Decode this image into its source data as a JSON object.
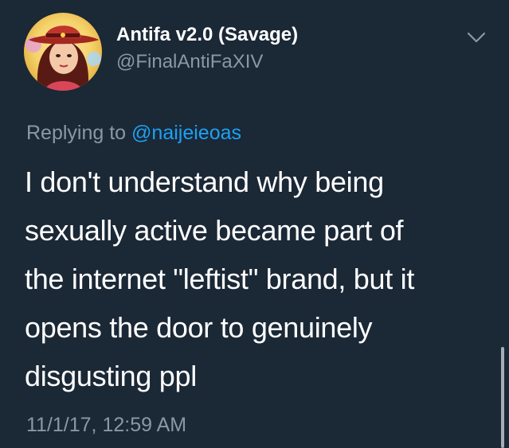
{
  "tweet": {
    "display_name": "Antifa v2.0 (Savage)",
    "handle": "@FinalAntiFaXIV",
    "replying_prefix": "Replying to ",
    "replying_to": "@naijeieoas",
    "text": "I don't understand why being\nsexually active became part of\nthe internet \"leftist\" brand, but it\nopens the door to genuinely\ndisgusting ppl",
    "timestamp": "11/1/17, 12:59 AM"
  },
  "icons": {
    "caret": "chevron-down-icon",
    "avatar": "avatar"
  },
  "colors": {
    "background": "#1b2836",
    "primary_text": "#ffffff",
    "secondary_text": "#8899a6",
    "link": "#1da1f2"
  }
}
